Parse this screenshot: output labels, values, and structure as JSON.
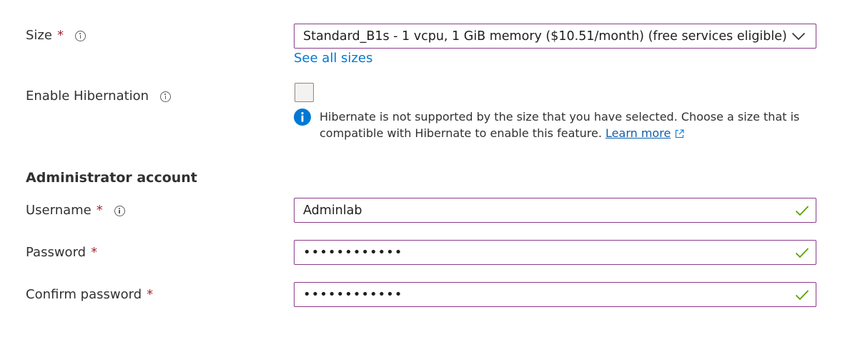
{
  "size": {
    "label": "Size",
    "required_mark": "*",
    "selected_value": "Standard_B1s - 1 vcpu, 1 GiB memory ($10.51/month)  (free services eligible)",
    "see_all_link": "See all sizes"
  },
  "hibernation": {
    "label": "Enable Hibernation",
    "checked": false,
    "info_message": "Hibernate is not supported by the size that you have selected. Choose a size that is compatible with Hibernate to enable this feature.",
    "learn_more_link": "Learn more"
  },
  "administrator_account": {
    "section_title": "Administrator account",
    "username": {
      "label": "Username",
      "required_mark": "*",
      "value": "Adminlab"
    },
    "password": {
      "label": "Password",
      "required_mark": "*",
      "value": "••••••••••••"
    },
    "confirm_password": {
      "label": "Confirm password",
      "required_mark": "*",
      "value": "••••••••••••"
    }
  },
  "colors": {
    "field_border": "#8a3c8a",
    "required": "#a4262c",
    "link": "#0078d4",
    "valid_check": "#57a300",
    "info_blue": "#0078d4"
  },
  "icons": {
    "field_info": "info-icon",
    "dropdown": "chevron-down-icon",
    "valid": "checkmark-icon",
    "message_info": "info-filled-icon",
    "external_link": "external-link-icon"
  }
}
